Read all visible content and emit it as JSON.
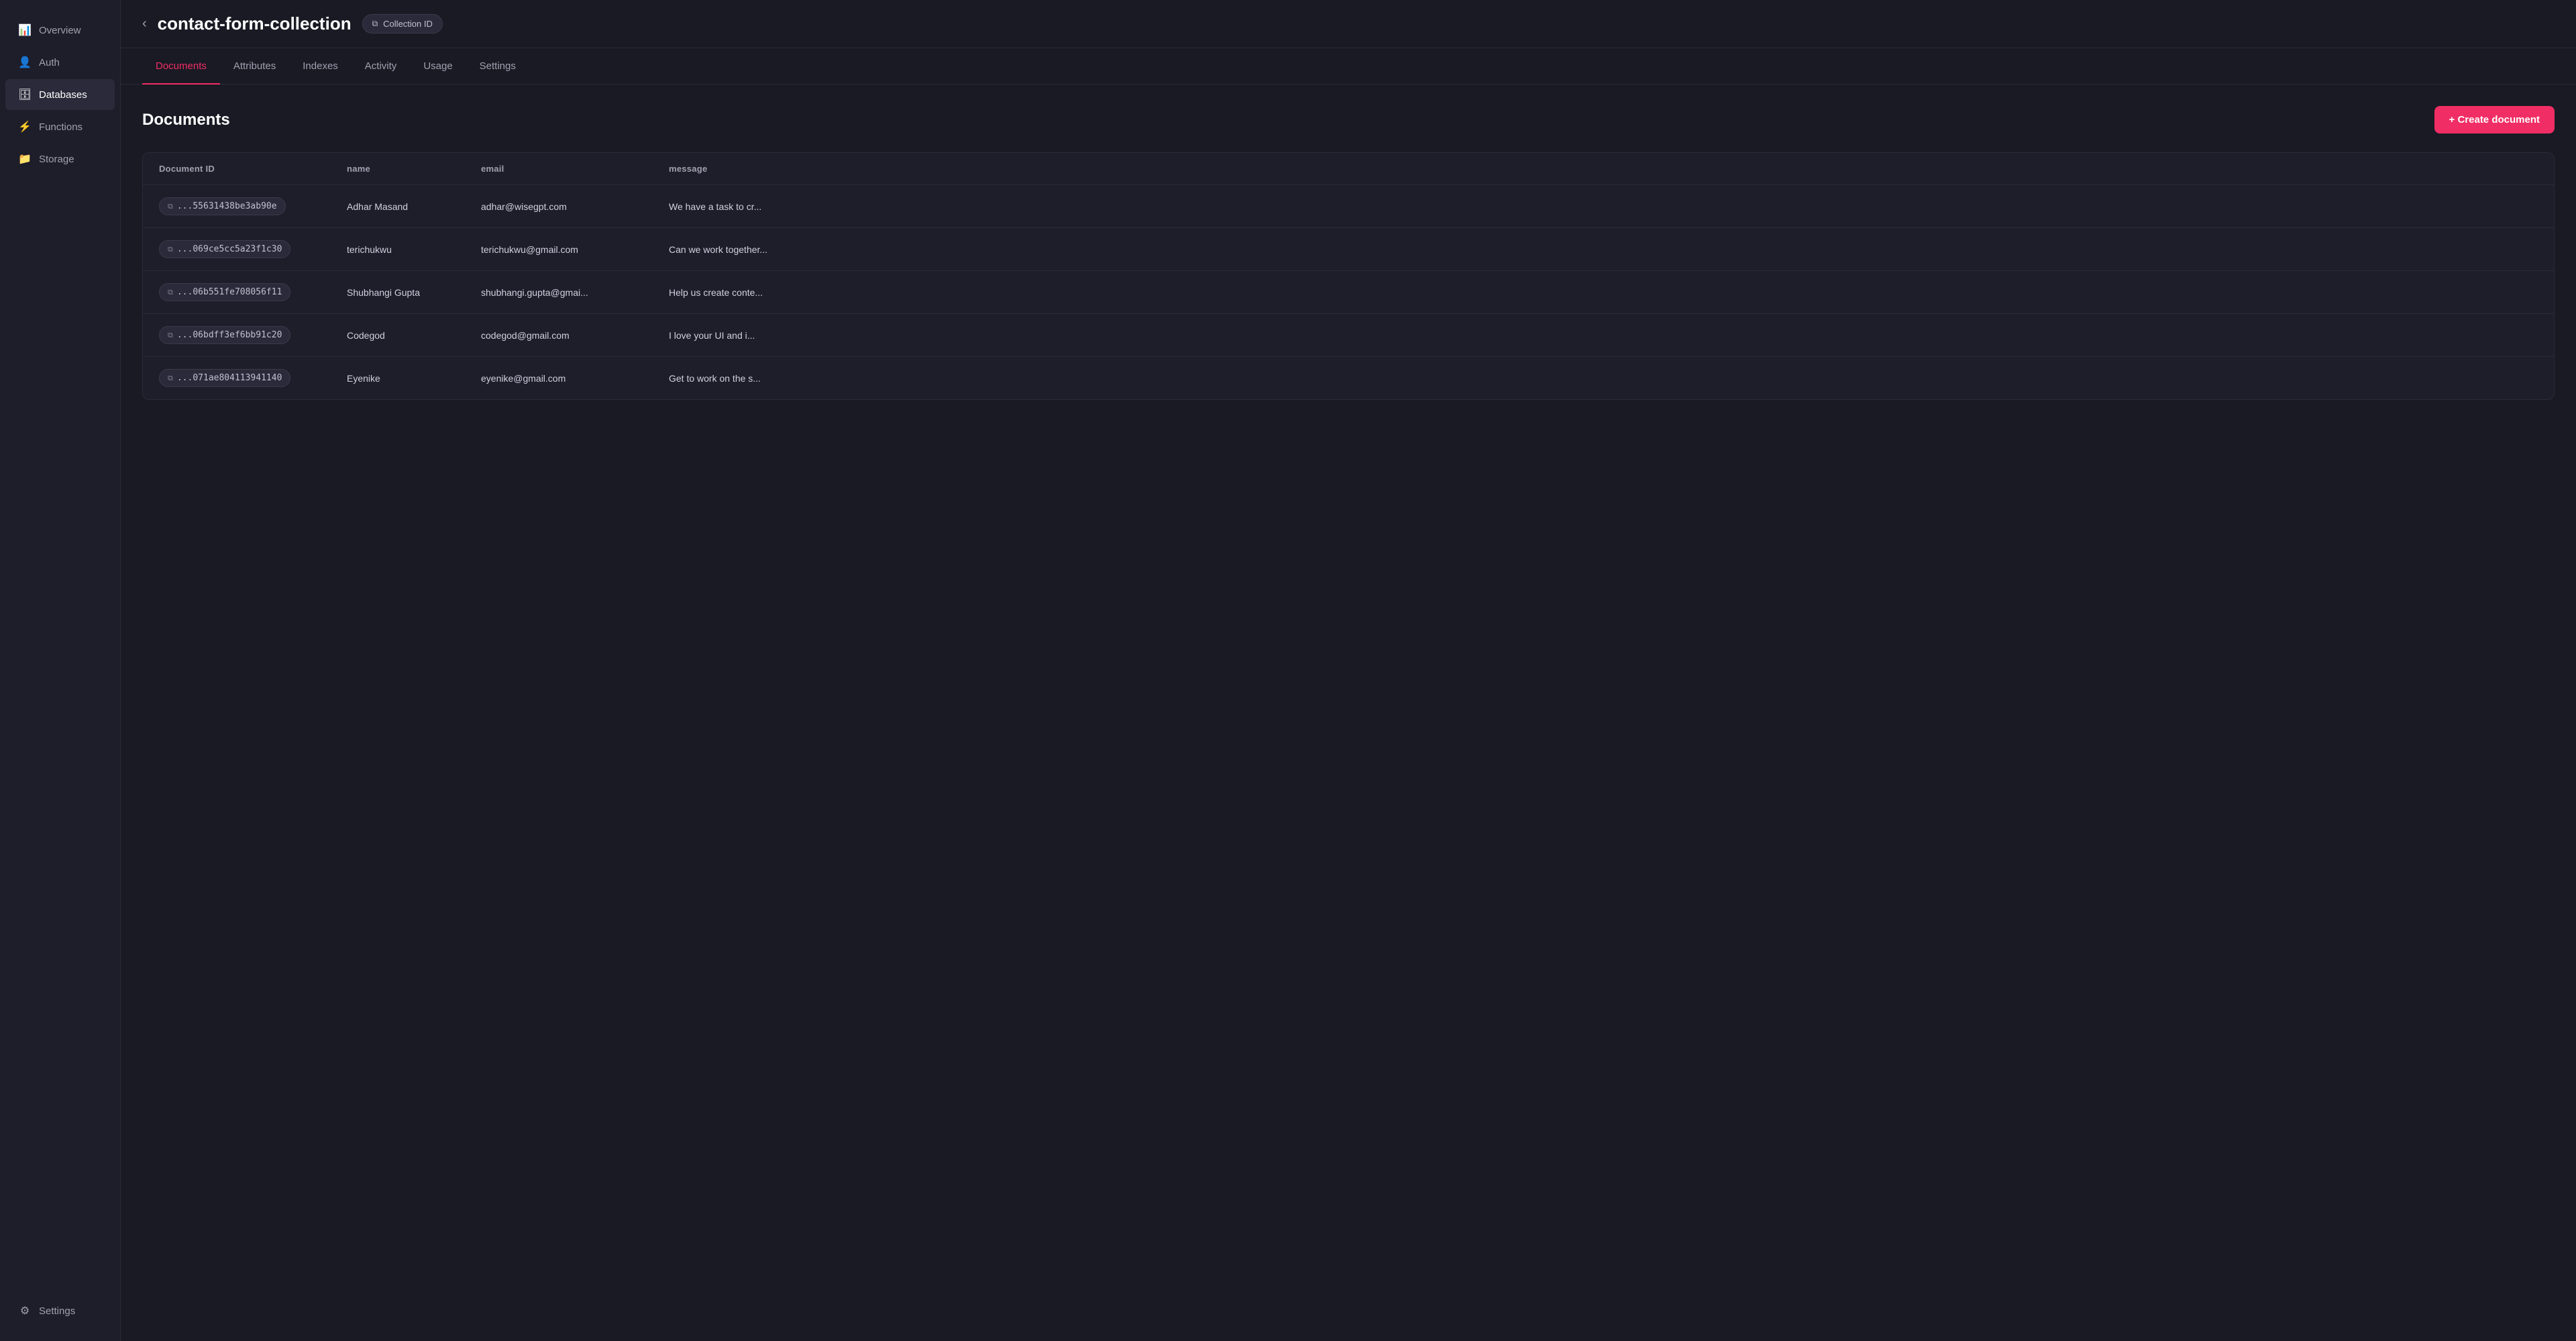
{
  "sidebar": {
    "items": [
      {
        "id": "overview",
        "label": "Overview",
        "icon": "📊",
        "active": false
      },
      {
        "id": "auth",
        "label": "Auth",
        "icon": "👤",
        "active": false
      },
      {
        "id": "databases",
        "label": "Databases",
        "icon": "🗄",
        "active": true
      },
      {
        "id": "functions",
        "label": "Functions",
        "icon": "⚡",
        "active": false
      },
      {
        "id": "storage",
        "label": "Storage",
        "icon": "📁",
        "active": false
      }
    ],
    "bottom_items": [
      {
        "id": "settings",
        "label": "Settings",
        "icon": "⚙",
        "active": false
      }
    ]
  },
  "header": {
    "back_label": "←",
    "title": "contact-form-collection",
    "collection_id_label": "Collection ID",
    "copy_icon": "⧉"
  },
  "tabs": [
    {
      "id": "documents",
      "label": "Documents",
      "active": true
    },
    {
      "id": "attributes",
      "label": "Attributes",
      "active": false
    },
    {
      "id": "indexes",
      "label": "Indexes",
      "active": false
    },
    {
      "id": "activity",
      "label": "Activity",
      "active": false
    },
    {
      "id": "usage",
      "label": "Usage",
      "active": false
    },
    {
      "id": "settings",
      "label": "Settings",
      "active": false
    }
  ],
  "content": {
    "title": "Documents",
    "create_button_label": "+ Create document",
    "table": {
      "columns": [
        {
          "id": "document_id",
          "label": "Document ID"
        },
        {
          "id": "name",
          "label": "name"
        },
        {
          "id": "email",
          "label": "email"
        },
        {
          "id": "message",
          "label": "message"
        }
      ],
      "rows": [
        {
          "document_id": "...55631438be3ab90e",
          "name": "Adhar Masand",
          "email": "adhar@wisegpt.com",
          "message": "We have a task to cr..."
        },
        {
          "document_id": "...069ce5cc5a23f1c30",
          "name": "terichukwu",
          "email": "terichukwu@gmail.com",
          "message": "Can we work together..."
        },
        {
          "document_id": "...06b551fe708056f11",
          "name": "Shubhangi Gupta",
          "email": "shubhangi.gupta@gmai...",
          "message": "Help us create conte..."
        },
        {
          "document_id": "...06bdff3ef6bb91c20",
          "name": "Codegod",
          "email": "codegod@gmail.com",
          "message": "I love your UI and i..."
        },
        {
          "document_id": "...071ae804113941140",
          "name": "Eyenike",
          "email": "eyenike@gmail.com",
          "message": "Get to work on the s..."
        }
      ]
    }
  },
  "colors": {
    "accent": "#f02e65",
    "sidebar_bg": "#1e1e2a",
    "main_bg": "#1a1a24",
    "active_tab": "#f02e65"
  }
}
